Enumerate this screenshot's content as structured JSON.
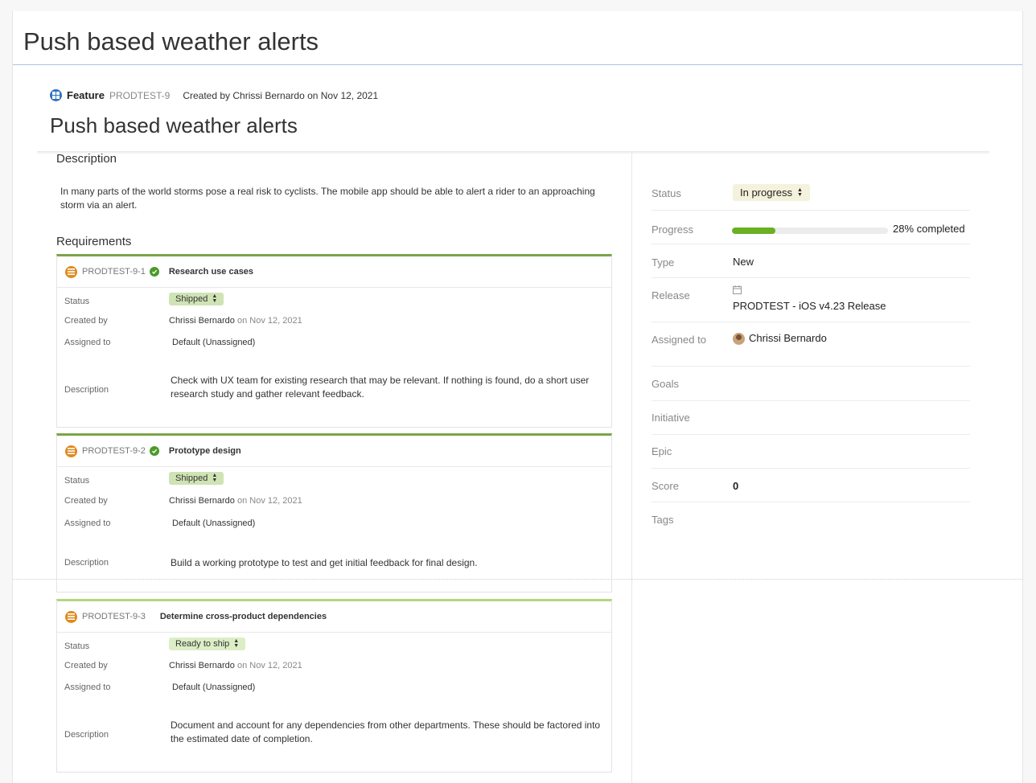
{
  "page": {
    "title": "Push based weather alerts"
  },
  "record": {
    "type": "Feature",
    "key": "PRODTEST-9",
    "created_prefix": "Created by ",
    "created_by": "Chrissi Bernardo",
    "created_on": " on Nov 12, 2021",
    "title": "Push based weather alerts"
  },
  "description": {
    "label": "Description",
    "text": "In many parts of the world storms pose a real risk to cyclists. The mobile app should be able to alert a rider to an approaching storm via an alert."
  },
  "requirements": {
    "label": "Requirements",
    "field_labels": {
      "status": "Status",
      "created_by": "Created by",
      "assigned_to": "Assigned to",
      "description": "Description"
    },
    "items": [
      {
        "key": "PRODTEST-9-1",
        "name": "Research use cases",
        "status": "Shipped",
        "created_by": "Chrissi Bernardo",
        "created_on": "on Nov 12, 2021",
        "assigned_to": "Default (Unassigned)",
        "description": "Check with UX team for existing research that may be relevant. If nothing is found, do a short user research study and gather relevant feedback."
      },
      {
        "key": "PRODTEST-9-2",
        "name": "Prototype design",
        "status": "Shipped",
        "created_by": "Chrissi Bernardo",
        "created_on": "on Nov 12, 2021",
        "assigned_to": "Default (Unassigned)",
        "description": "Build a working prototype to test and get initial feedback for final design."
      },
      {
        "key": "PRODTEST-9-3",
        "name": "Determine cross-product dependencies",
        "status": "Ready to ship",
        "created_by": "Chrissi Bernardo",
        "created_on": "on Nov 12, 2021",
        "assigned_to": "Default (Unassigned)",
        "description": "Document and account for any dependencies from other departments. These should be factored into the estimated date of completion."
      }
    ]
  },
  "properties": {
    "status": {
      "label": "Status",
      "value": "In progress"
    },
    "progress": {
      "label": "Progress",
      "percent": 28,
      "text": "28% completed"
    },
    "type": {
      "label": "Type",
      "value": "New"
    },
    "release": {
      "label": "Release",
      "value": "PRODTEST - iOS v4.23 Release"
    },
    "assigned_to": {
      "label": "Assigned to",
      "value": "Chrissi Bernardo"
    },
    "goals": {
      "label": "Goals",
      "value": ""
    },
    "initiative": {
      "label": "Initiative",
      "value": ""
    },
    "epic": {
      "label": "Epic",
      "value": ""
    },
    "score": {
      "label": "Score",
      "value": "0"
    },
    "tags": {
      "label": "Tags",
      "value": ""
    }
  },
  "colors": {
    "feature_icon": "#2f74c0",
    "requirement_icon": "#e08a1e",
    "shipped_check": "#4c9a2a",
    "progress_fill": "#6ab023"
  },
  "icons": [
    "feature-icon",
    "requirement-icon",
    "check-icon",
    "calendar-icon",
    "avatar",
    "sort-arrows-icon"
  ]
}
